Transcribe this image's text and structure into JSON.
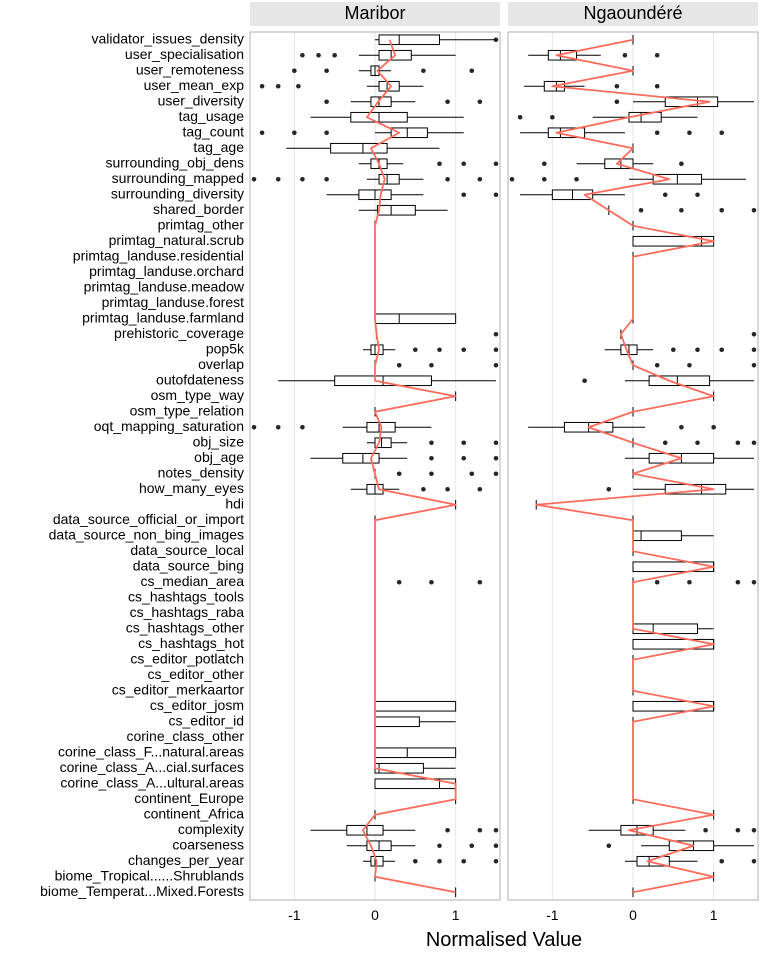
{
  "chart_data": {
    "type": "boxplot-grid",
    "xlabel": "Normalised Value",
    "x_ticks": [
      -1,
      0,
      1
    ],
    "x_range": [
      -1.55,
      1.55
    ],
    "facets": [
      "Maribor",
      "Ngaoundéré"
    ],
    "categories": [
      "validator_issues_density",
      "user_specialisation",
      "user_remoteness",
      "user_mean_exp",
      "user_diversity",
      "tag_usage",
      "tag_count",
      "tag_age",
      "surrounding_obj_dens",
      "surrounding_mapped",
      "surrounding_diversity",
      "shared_border",
      "primtag_other",
      "primtag_natural.scrub",
      "primtag_landuse.residential",
      "primtag_landuse.orchard",
      "primtag_landuse.meadow",
      "primtag_landuse.forest",
      "primtag_landuse.farmland",
      "prehistoric_coverage",
      "pop5k",
      "overlap",
      "outofdateness",
      "osm_type_way",
      "osm_type_relation",
      "oqt_mapping_saturation",
      "obj_size",
      "obj_age",
      "notes_density",
      "how_many_eyes",
      "hdi",
      "data_source_official_or_import",
      "data_source_non_bing_images",
      "data_source_local",
      "data_source_bing",
      "cs_median_area",
      "cs_hashtags_tools",
      "cs_hashtags_raba",
      "cs_hashtags_other",
      "cs_hashtags_hot",
      "cs_editor_potlatch",
      "cs_editor_other",
      "cs_editor_merkaartor",
      "cs_editor_josm",
      "cs_editor_id",
      "corine_class_other",
      "corine_class_F...natural.areas",
      "corine_class_A...cial.surfaces",
      "corine_class_A...ultural.areas",
      "continent_Europe",
      "continent_Africa",
      "complexity",
      "coarseness",
      "changes_per_year",
      "biome_Tropical......Shrublands",
      "biome_Temperat...Mixed.Forests"
    ],
    "series": {
      "Maribor": [
        {
          "q1": 0.05,
          "med": 0.3,
          "q3": 0.8,
          "lw": 0.0,
          "uw": 1.5,
          "mean": 0.18,
          "outliers": [
            1.5
          ]
        },
        {
          "q1": 0.05,
          "med": 0.2,
          "q3": 0.45,
          "lw": -0.2,
          "uw": 1.0,
          "mean": 0.25,
          "outliers": [
            -0.5,
            -0.7,
            -0.9
          ]
        },
        {
          "q1": -0.05,
          "med": 0.0,
          "q3": 0.05,
          "lw": -0.2,
          "uw": 0.2,
          "mean": 0.03,
          "outliers": [
            -0.6,
            -1.0,
            0.6,
            1.2
          ]
        },
        {
          "q1": 0.05,
          "med": 0.15,
          "q3": 0.3,
          "lw": -0.1,
          "uw": 0.6,
          "mean": 0.2,
          "outliers": [
            -0.95,
            -1.2,
            -1.4
          ]
        },
        {
          "q1": -0.05,
          "med": 0.05,
          "q3": 0.2,
          "lw": -0.3,
          "uw": 0.5,
          "mean": 0.04,
          "outliers": [
            -0.6,
            0.9,
            1.3
          ]
        },
        {
          "q1": -0.3,
          "med": 0.05,
          "q3": 0.4,
          "lw": -0.8,
          "uw": 1.1,
          "mean": -0.1,
          "outliers": []
        },
        {
          "q1": 0.2,
          "med": 0.4,
          "q3": 0.65,
          "lw": 0.0,
          "uw": 1.1,
          "mean": 0.3,
          "outliers": [
            -0.6,
            -1.0,
            -1.4
          ]
        },
        {
          "q1": -0.55,
          "med": -0.15,
          "q3": 0.15,
          "lw": -1.1,
          "uw": 0.8,
          "mean": -0.05,
          "outliers": []
        },
        {
          "q1": -0.05,
          "med": 0.05,
          "q3": 0.15,
          "lw": -0.2,
          "uw": 0.35,
          "mean": 0.05,
          "outliers": [
            0.8,
            1.1,
            1.5
          ]
        },
        {
          "q1": 0.05,
          "med": 0.15,
          "q3": 0.3,
          "lw": -0.1,
          "uw": 0.6,
          "mean": 0.12,
          "outliers": [
            -1.5,
            -1.2,
            -0.9,
            -0.6,
            0.9,
            1.3
          ]
        },
        {
          "q1": -0.2,
          "med": 0.0,
          "q3": 0.2,
          "lw": -0.6,
          "uw": 0.6,
          "mean": 0.07,
          "outliers": [
            1.1,
            1.5
          ]
        },
        {
          "q1": 0.03,
          "med": 0.2,
          "q3": 0.5,
          "lw": -0.2,
          "uw": 0.9,
          "mean": 0.05,
          "outliers": []
        },
        {
          "single": 0.0,
          "mean": 0.0
        },
        {
          "single": 0.0,
          "mean": 0.0
        },
        {
          "single": 0.0,
          "mean": 0.0
        },
        {
          "single": 0.0,
          "mean": 0.0
        },
        {
          "single": 0.0,
          "mean": 0.0
        },
        {
          "single": 0.0,
          "mean": 0.0
        },
        {
          "q1": 0.0,
          "med": 0.3,
          "q3": 1.0,
          "lw": 0.0,
          "uw": 1.0,
          "mean": 0.0,
          "outliers": []
        },
        {
          "single": 0.02,
          "mean": 0.02,
          "outliers": [
            1.5
          ]
        },
        {
          "q1": -0.05,
          "med": 0.0,
          "q3": 0.1,
          "lw": -0.15,
          "uw": 0.25,
          "mean": 0.05,
          "outliers": [
            0.5,
            0.8,
            1.1,
            1.5
          ]
        },
        {
          "single": 0.0,
          "mean": 0.0,
          "outliers": [
            0.3,
            0.7,
            1.5
          ]
        },
        {
          "q1": -0.5,
          "med": 0.1,
          "q3": 0.7,
          "lw": -1.2,
          "uw": 1.5,
          "mean": 0.0,
          "outliers": []
        },
        {
          "single": 1.0,
          "mean": 1.0
        },
        {
          "single": 0.0,
          "mean": 0.0
        },
        {
          "q1": -0.1,
          "med": 0.05,
          "q3": 0.25,
          "lw": -0.4,
          "uw": 0.7,
          "mean": 0.08,
          "outliers": [
            -1.5,
            -1.2,
            -0.9
          ]
        },
        {
          "q1": 0.0,
          "med": 0.08,
          "q3": 0.2,
          "lw": -0.1,
          "uw": 0.4,
          "mean": 0.05,
          "outliers": [
            0.7,
            1.1,
            1.5
          ]
        },
        {
          "q1": -0.4,
          "med": -0.15,
          "q3": 0.05,
          "lw": -0.8,
          "uw": 0.4,
          "mean": -0.05,
          "outliers": [
            0.7,
            1.1,
            1.5
          ]
        },
        {
          "single": 0.0,
          "mean": 0.0,
          "outliers": [
            0.3,
            0.7,
            1.2,
            1.5
          ]
        },
        {
          "q1": -0.1,
          "med": 0.0,
          "q3": 0.1,
          "lw": -0.3,
          "uw": 0.3,
          "mean": 0.05,
          "outliers": [
            0.6,
            0.9,
            1.3
          ]
        },
        {
          "single": 1.0,
          "mean": 1.0
        },
        {
          "single": 0.0,
          "mean": 0.0
        },
        {
          "single": 0.0,
          "mean": 0.0
        },
        {
          "single": 0.0,
          "mean": 0.0
        },
        {
          "single": 0.0,
          "mean": 0.0
        },
        {
          "single": 0.0,
          "mean": 0.0,
          "outliers": [
            0.3,
            0.7,
            1.3
          ]
        },
        {
          "single": 0.0,
          "mean": 0.0
        },
        {
          "single": 0.0,
          "mean": 0.0
        },
        {
          "single": 0.0,
          "mean": 0.0
        },
        {
          "single": 0.0,
          "mean": 0.0
        },
        {
          "single": 0.0,
          "mean": 0.0
        },
        {
          "single": 0.0,
          "mean": 0.0
        },
        {
          "single": 0.0,
          "mean": 0.0
        },
        {
          "q1": 0.0,
          "med": 0.0,
          "q3": 1.0,
          "lw": 0.0,
          "uw": 1.0,
          "mean": 0.0,
          "outliers": []
        },
        {
          "q1": 0.0,
          "med": 0.0,
          "q3": 0.55,
          "lw": 0.0,
          "uw": 1.0,
          "mean": 0.0,
          "outliers": []
        },
        {
          "single": 0.0,
          "mean": 0.0
        },
        {
          "q1": 0.0,
          "med": 0.4,
          "q3": 1.0,
          "lw": 0.0,
          "uw": 1.0,
          "mean": 0.0,
          "outliers": []
        },
        {
          "q1": 0.0,
          "med": 0.05,
          "q3": 0.6,
          "lw": 0.0,
          "uw": 1.0,
          "mean": 0.0,
          "outliers": []
        },
        {
          "q1": 0.0,
          "med": 0.8,
          "q3": 1.0,
          "lw": 0.0,
          "uw": 1.0,
          "mean": 1.0,
          "outliers": []
        },
        {
          "single": 1.0,
          "mean": 1.0
        },
        {
          "single": 0.0,
          "mean": 0.0
        },
        {
          "q1": -0.35,
          "med": -0.1,
          "q3": 0.1,
          "lw": -0.8,
          "uw": 0.5,
          "mean": -0.15,
          "outliers": [
            0.9,
            1.3,
            1.5
          ]
        },
        {
          "q1": -0.1,
          "med": 0.05,
          "q3": 0.2,
          "lw": -0.35,
          "uw": 0.5,
          "mean": -0.05,
          "outliers": [
            0.8,
            1.2,
            1.5
          ]
        },
        {
          "q1": -0.05,
          "med": 0.0,
          "q3": 0.1,
          "lw": -0.15,
          "uw": 0.25,
          "mean": 0.02,
          "outliers": [
            0.5,
            0.8,
            1.1,
            1.5
          ]
        },
        {
          "single": 0.0,
          "mean": 0.0
        },
        {
          "single": 1.0,
          "mean": 1.0
        }
      ],
      "Ngaoundéré": [
        {
          "single": 0.0,
          "mean": 0.0
        },
        {
          "q1": -1.05,
          "med": -0.9,
          "q3": -0.7,
          "lw": -1.3,
          "uw": -0.4,
          "mean": -0.95,
          "outliers": [
            -0.1,
            0.3
          ]
        },
        {
          "single": 0.0,
          "mean": 0.0
        },
        {
          "q1": -1.1,
          "med": -0.95,
          "q3": -0.85,
          "lw": -1.35,
          "uw": -0.6,
          "mean": -1.0,
          "outliers": [
            -0.2,
            0.3
          ]
        },
        {
          "q1": 0.4,
          "med": 0.8,
          "q3": 1.05,
          "lw": 0.0,
          "uw": 1.5,
          "mean": 0.95,
          "outliers": [
            -0.2
          ]
        },
        {
          "q1": -0.05,
          "med": 0.1,
          "q3": 0.35,
          "lw": -0.5,
          "uw": 0.8,
          "mean": -0.05,
          "outliers": [
            -1.0,
            -1.4
          ]
        },
        {
          "q1": -1.05,
          "med": -0.9,
          "q3": -0.6,
          "lw": -1.4,
          "uw": -0.1,
          "mean": -0.95,
          "outliers": [
            0.3,
            0.7,
            1.1
          ]
        },
        {
          "single": 0.0,
          "mean": 0.0
        },
        {
          "q1": -0.35,
          "med": -0.15,
          "q3": 0.0,
          "lw": -0.7,
          "uw": 0.25,
          "mean": -0.2,
          "outliers": [
            -1.1,
            0.6
          ]
        },
        {
          "q1": 0.25,
          "med": 0.55,
          "q3": 0.85,
          "lw": -0.05,
          "uw": 1.4,
          "mean": 0.45,
          "outliers": [
            -1.5,
            -1.1,
            -0.7
          ]
        },
        {
          "q1": -1.0,
          "med": -0.75,
          "q3": -0.5,
          "lw": -1.4,
          "uw": -0.1,
          "mean": -0.6,
          "outliers": [
            0.4,
            0.8
          ]
        },
        {
          "single": -0.3,
          "mean": -0.3,
          "outliers": [
            0.1,
            0.6,
            1.1,
            1.5
          ]
        },
        {
          "single": 0.0,
          "mean": 0.0
        },
        {
          "q1": 0.0,
          "med": 0.85,
          "q3": 1.0,
          "lw": 0.0,
          "uw": 1.0,
          "mean": 1.0,
          "outliers": []
        },
        {
          "single": 0.0,
          "mean": 0.0
        },
        {
          "single": 0.0,
          "mean": 0.0
        },
        {
          "single": 0.0,
          "mean": 0.0
        },
        {
          "single": 0.0,
          "mean": 0.0
        },
        {
          "single": 0.0,
          "mean": 0.0
        },
        {
          "single": -0.15,
          "mean": -0.15,
          "outliers": [
            1.5
          ]
        },
        {
          "q1": -0.15,
          "med": -0.05,
          "q3": 0.05,
          "lw": -0.35,
          "uw": 0.25,
          "mean": -0.08,
          "outliers": [
            0.5,
            0.8,
            1.1,
            1.5
          ]
        },
        {
          "single": 0.0,
          "mean": 0.0,
          "outliers": [
            0.3,
            0.7,
            1.5
          ]
        },
        {
          "q1": 0.2,
          "med": 0.55,
          "q3": 0.95,
          "lw": -0.1,
          "uw": 1.5,
          "mean": 0.45,
          "outliers": [
            -0.6
          ]
        },
        {
          "single": 1.0,
          "mean": 1.0
        },
        {
          "single": 0.0,
          "mean": 0.0
        },
        {
          "q1": -0.85,
          "med": -0.55,
          "q3": -0.25,
          "lw": -1.3,
          "uw": 0.15,
          "mean": -0.55,
          "outliers": [
            0.6,
            1.0
          ]
        },
        {
          "single": 0.0,
          "mean": 0.0,
          "outliers": [
            0.4,
            0.8,
            1.3,
            1.5
          ]
        },
        {
          "q1": 0.2,
          "med": 0.6,
          "q3": 1.0,
          "lw": -0.1,
          "uw": 1.5,
          "mean": 0.6,
          "outliers": []
        },
        {
          "single": 0.0,
          "mean": 0.0
        },
        {
          "q1": 0.4,
          "med": 0.85,
          "q3": 1.15,
          "lw": 0.0,
          "uw": 1.5,
          "mean": 1.0,
          "outliers": [
            -0.3
          ]
        },
        {
          "single": -1.2,
          "mean": -1.2
        },
        {
          "single": 0.0,
          "mean": 0.0
        },
        {
          "q1": 0.0,
          "med": 0.1,
          "q3": 0.6,
          "lw": 0.0,
          "uw": 1.0,
          "mean": 0.0,
          "outliers": []
        },
        {
          "single": 0.0,
          "mean": 0.0
        },
        {
          "q1": 0.0,
          "med": 1.0,
          "q3": 1.0,
          "lw": 0.0,
          "uw": 1.0,
          "mean": 1.0,
          "outliers": []
        },
        {
          "single": 0.0,
          "mean": 0.0,
          "outliers": [
            0.3,
            0.7,
            1.3,
            1.5
          ]
        },
        {
          "single": 0.0,
          "mean": 0.0
        },
        {
          "single": 0.0,
          "mean": 0.0
        },
        {
          "q1": 0.0,
          "med": 0.25,
          "q3": 0.8,
          "lw": 0.0,
          "uw": 1.0,
          "mean": 0.0,
          "outliers": []
        },
        {
          "q1": 0.0,
          "med": 1.0,
          "q3": 1.0,
          "lw": 0.0,
          "uw": 1.0,
          "mean": 1.0,
          "outliers": []
        },
        {
          "single": 0.0,
          "mean": 0.0
        },
        {
          "single": 0.0,
          "mean": 0.0
        },
        {
          "single": 0.0,
          "mean": 0.0
        },
        {
          "q1": 0.0,
          "med": 1.0,
          "q3": 1.0,
          "lw": 0.0,
          "uw": 1.0,
          "mean": 1.0,
          "outliers": []
        },
        {
          "single": 0.0,
          "mean": 0.0
        },
        {
          "single": 0.0,
          "mean": 0.0
        },
        {
          "single": 0.0,
          "mean": 0.0
        },
        {
          "single": 0.0,
          "mean": 0.0
        },
        {
          "single": 0.0,
          "mean": 0.0
        },
        {
          "single": 0.0,
          "mean": 0.0
        },
        {
          "single": 1.0,
          "mean": 1.0
        },
        {
          "q1": -0.15,
          "med": 0.05,
          "q3": 0.25,
          "lw": -0.55,
          "uw": 0.65,
          "mean": -0.05,
          "outliers": [
            0.9,
            1.3,
            1.5
          ]
        },
        {
          "q1": 0.45,
          "med": 0.75,
          "q3": 1.0,
          "lw": 0.1,
          "uw": 1.5,
          "mean": 0.75,
          "outliers": [
            -0.3
          ]
        },
        {
          "q1": 0.05,
          "med": 0.2,
          "q3": 0.45,
          "lw": -0.1,
          "uw": 0.8,
          "mean": 0.18,
          "outliers": [
            1.1,
            1.5
          ]
        },
        {
          "single": 1.0,
          "mean": 1.0
        },
        {
          "single": 0.0,
          "mean": 0.0
        }
      ]
    }
  }
}
